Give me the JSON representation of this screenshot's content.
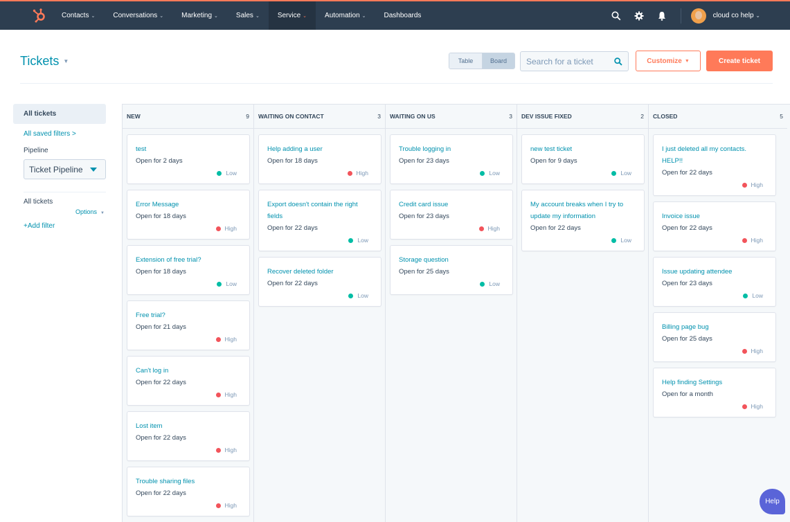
{
  "nav": {
    "items": [
      {
        "label": "Contacts",
        "has_menu": true
      },
      {
        "label": "Conversations",
        "has_menu": true
      },
      {
        "label": "Marketing",
        "has_menu": true
      },
      {
        "label": "Sales",
        "has_menu": true
      },
      {
        "label": "Service",
        "has_menu": true,
        "active": true
      },
      {
        "label": "Automation",
        "has_menu": true
      },
      {
        "label": "Dashboards",
        "has_menu": false
      }
    ],
    "icons": [
      "search-icon",
      "gear-icon",
      "bell-icon"
    ],
    "account_name": "cloud co help",
    "caret": "⌄"
  },
  "header": {
    "title": "Tickets",
    "title_caret": "▼",
    "view_toggle": {
      "table": "Table",
      "board": "Board",
      "selected": "Board"
    },
    "search_placeholder": "Search for a ticket",
    "customize_label": "Customize",
    "create_label": "Create ticket"
  },
  "sidebar": {
    "current_view": "All tickets",
    "saved_filters_link": "All saved filters >",
    "pipeline_label": "Pipeline",
    "pipeline_value": "Ticket Pipeline",
    "filter_view_label": "All tickets",
    "options_label": "Options",
    "add_filter_label": "+Add filter"
  },
  "colors": {
    "accent": "#ff7a59",
    "link": "#0091ae",
    "nav_bg": "#2d3e50",
    "priority_low": "#00bda5",
    "priority_high": "#f2545b",
    "help": "#5a64d8"
  },
  "board": {
    "columns": [
      {
        "name": "NEW",
        "count": "9",
        "cards": [
          {
            "title": "test",
            "age": "Open for 2 days",
            "priority": "Low"
          },
          {
            "title": "Error Message",
            "age": "Open for 18 days",
            "priority": "High"
          },
          {
            "title": "Extension of free trial?",
            "age": "Open for 18 days",
            "priority": "Low"
          },
          {
            "title": "Free trial?",
            "age": "Open for 21 days",
            "priority": "High"
          },
          {
            "title": "Can't log in",
            "age": "Open for 22 days",
            "priority": "High"
          },
          {
            "title": "Lost item",
            "age": "Open for 22 days",
            "priority": "High"
          },
          {
            "title": "Trouble sharing files",
            "age": "Open for 22 days",
            "priority": "High"
          }
        ]
      },
      {
        "name": "WAITING ON CONTACT",
        "count": "3",
        "cards": [
          {
            "title": "Help adding a user",
            "age": "Open for 18 days",
            "priority": "High"
          },
          {
            "title": "Export doesn't contain the right fields",
            "age": "Open for 22 days",
            "priority": "Low"
          },
          {
            "title": "Recover deleted folder",
            "age": "Open for 22 days",
            "priority": "Low"
          }
        ]
      },
      {
        "name": "WAITING ON US",
        "count": "3",
        "cards": [
          {
            "title": "Trouble logging in",
            "age": "Open for 23 days",
            "priority": "Low"
          },
          {
            "title": "Credit card issue",
            "age": "Open for 23 days",
            "priority": "High"
          },
          {
            "title": "Storage question",
            "age": "Open for 25 days",
            "priority": "Low"
          }
        ]
      },
      {
        "name": "DEV ISSUE FIXED",
        "count": "2",
        "cards": [
          {
            "title": "new test ticket",
            "age": "Open for 9 days",
            "priority": "Low"
          },
          {
            "title": "My account breaks when I try to update my information",
            "age": "Open for 22 days",
            "priority": "Low"
          }
        ]
      },
      {
        "name": "CLOSED",
        "count": "5",
        "cards": [
          {
            "title": "I just deleted all my contacts. HELP!!",
            "age": "Open for 22 days",
            "priority": "High"
          },
          {
            "title": "Invoice issue",
            "age": "Open for 22 days",
            "priority": "High"
          },
          {
            "title": "Issue updating attendee",
            "age": "Open for 23 days",
            "priority": "Low"
          },
          {
            "title": "Billing page bug",
            "age": "Open for 25 days",
            "priority": "High"
          },
          {
            "title": "Help finding Settings",
            "age": "Open for a month",
            "priority": "High"
          }
        ]
      }
    ]
  },
  "help_label": "Help"
}
